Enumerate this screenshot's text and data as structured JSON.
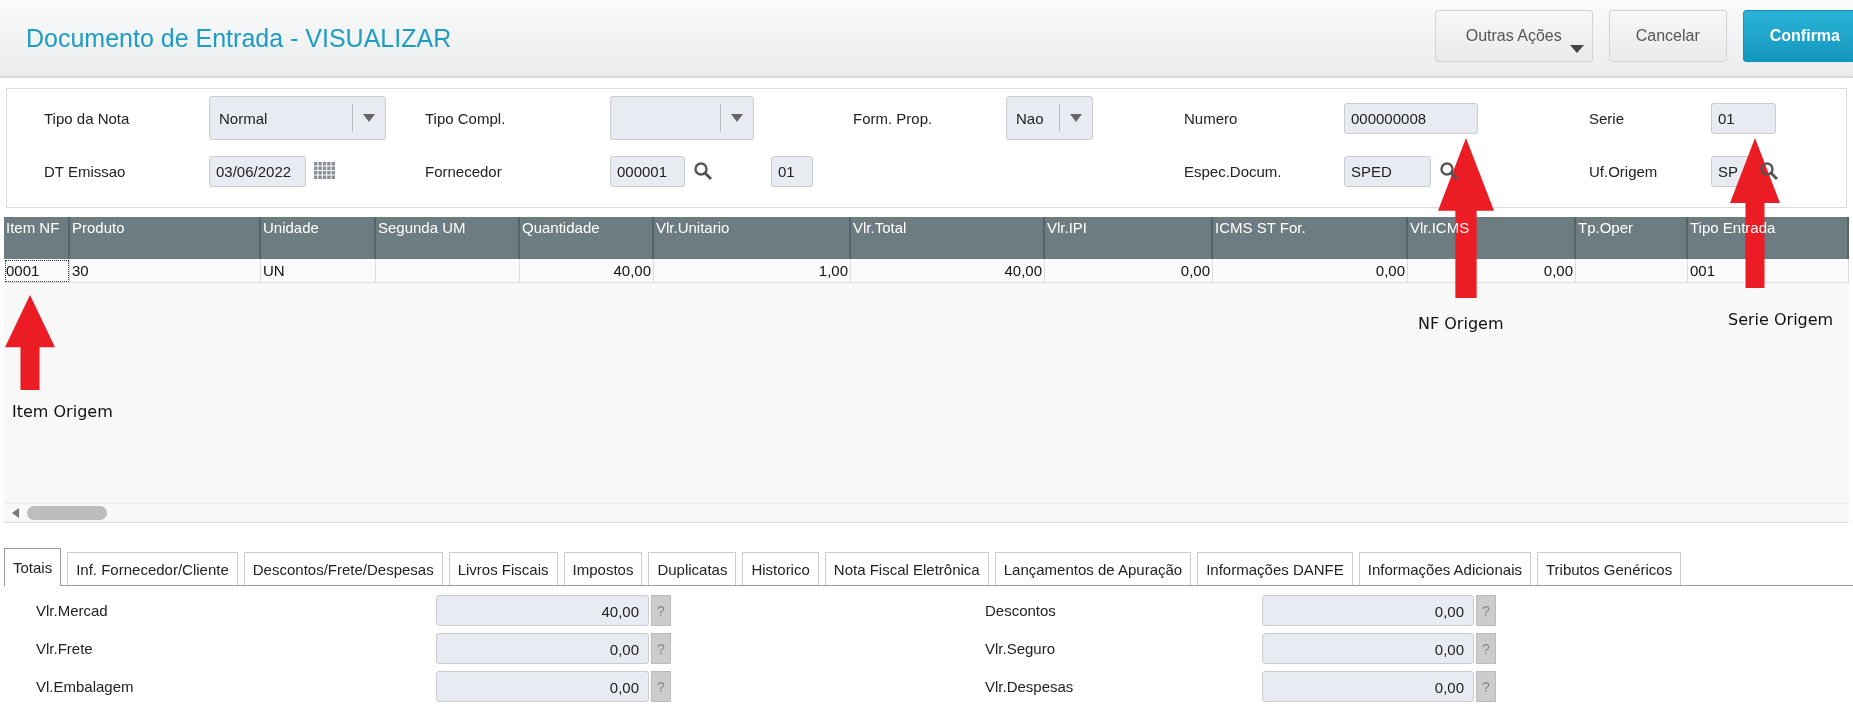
{
  "header": {
    "title": "Documento de Entrada - VISUALIZAR",
    "buttons": [
      {
        "label": "Outras Ações",
        "kind": "menu"
      },
      {
        "label": "Cancelar",
        "kind": "default"
      },
      {
        "label": "Confirma",
        "kind": "primary"
      }
    ]
  },
  "form": {
    "columns": [
      [
        {
          "label": "Tipo da Nota",
          "kind": "select",
          "value": "Normal"
        },
        {
          "label": "DT Emissao",
          "kind": "date",
          "value": "03/06/2022"
        }
      ],
      [
        {
          "label": "Tipo Compl.",
          "kind": "select"
        },
        {
          "label": "Fornecedor",
          "kind": "lookup",
          "value": "000001",
          "extra": "01"
        }
      ],
      [
        {
          "label": "Form. Prop.",
          "kind": "select",
          "value": "Nao"
        }
      ],
      [
        {
          "label": "Numero",
          "kind": "input",
          "value": "000000008"
        },
        {
          "label": "Espec.Docum.",
          "kind": "lookup",
          "value": "SPED"
        }
      ],
      [
        {
          "label": "Serie",
          "kind": "input",
          "value": "01"
        },
        {
          "label": "Uf.Origem",
          "kind": "lookup",
          "value": "SP"
        }
      ]
    ]
  },
  "table": {
    "columns": [
      {
        "label": "Item NF",
        "kind": "text"
      },
      {
        "label": "Produto",
        "kind": "text"
      },
      {
        "label": "Unidade",
        "kind": "text"
      },
      {
        "label": "Segunda UM",
        "kind": "text"
      },
      {
        "label": "Quantidade",
        "kind": "number"
      },
      {
        "label": "Vlr.Unitario",
        "kind": "number"
      },
      {
        "label": "Vlr.Total",
        "kind": "number"
      },
      {
        "label": "Vlr.IPI",
        "kind": "number"
      },
      {
        "label": "ICMS ST For.",
        "kind": "number"
      },
      {
        "label": "Vlr.ICMS",
        "kind": "number"
      },
      {
        "label": "Tp.Oper",
        "kind": "text"
      },
      {
        "label": "Tipo Entrada",
        "kind": "text"
      }
    ],
    "rows": [
      {
        "selected": true,
        "cells": [
          "0001",
          "30",
          "UN",
          null,
          "40,00",
          "1,00",
          "40,00",
          "0,00",
          "0,00",
          "0,00",
          null,
          "001"
        ]
      }
    ]
  },
  "tabs": [
    {
      "label": "Totais",
      "selected": true
    },
    {
      "label": "Inf. Fornecedor/Cliente",
      "selected": false
    },
    {
      "label": "Descontos/Frete/Despesas",
      "selected": false
    },
    {
      "label": "Livros Fiscais",
      "selected": false
    },
    {
      "label": "Impostos",
      "selected": false
    },
    {
      "label": "Duplicatas",
      "selected": false
    },
    {
      "label": "Historico",
      "selected": false
    },
    {
      "label": "Nota Fiscal Eletrônica",
      "selected": false
    },
    {
      "label": "Lançamentos de Apuração",
      "selected": false
    },
    {
      "label": "Informações DANFE",
      "selected": false
    },
    {
      "label": "Informações Adicionais",
      "selected": false
    },
    {
      "label": "Tributos Genéricos",
      "selected": false
    }
  ],
  "totals": {
    "columns": [
      [
        {
          "label": "Vlr.Mercad",
          "value": "40,00",
          "help": "?"
        },
        {
          "label": "Vlr.Frete",
          "value": "0,00",
          "help": "?"
        },
        {
          "label": "Vl.Embalagem",
          "value": "0,00",
          "help": "?"
        }
      ],
      [
        {
          "label": "Descontos",
          "value": "0,00",
          "help": "?"
        },
        {
          "label": "Vlr.Seguro",
          "value": "0,00",
          "help": "?"
        },
        {
          "label": "Vlr.Despesas",
          "value": "0,00",
          "help": "?"
        }
      ]
    ]
  },
  "annotations": [
    {
      "label": "Item Origem"
    },
    {
      "label": "NF Origem"
    },
    {
      "label": "Serie Origem"
    }
  ]
}
